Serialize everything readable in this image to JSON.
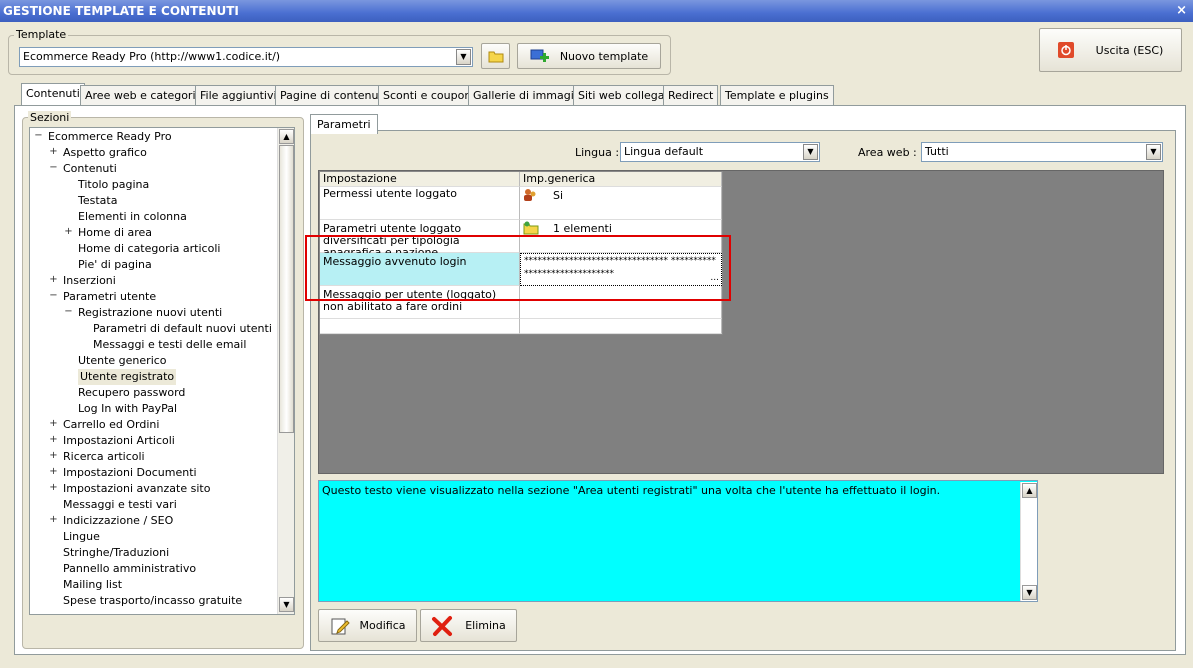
{
  "window": {
    "title": "GESTIONE TEMPLATE E CONTENUTI",
    "close_glyph": "×"
  },
  "template_group": {
    "label": "Template",
    "selected": "Ecommerce Ready Pro (http://www1.codice.it/)",
    "new_template_label": "Nuovo template"
  },
  "exit_button": {
    "label": "Uscita (ESC)"
  },
  "tabs": [
    {
      "label": "Contenuti",
      "active": true
    },
    {
      "label": "Aree web e categorie"
    },
    {
      "label": "File aggiuntivi"
    },
    {
      "label": "Pagine di contenuti"
    },
    {
      "label": "Sconti e coupon"
    },
    {
      "label": "Gallerie di immagini"
    },
    {
      "label": "Siti web collegati"
    },
    {
      "label": "Redirect"
    },
    {
      "label": "Template e plugins"
    }
  ],
  "sections": {
    "label": "Sezioni",
    "tree": [
      {
        "label": "Ecommerce Ready Pro",
        "level": 0,
        "exp": "−"
      },
      {
        "label": "Aspetto grafico",
        "level": 1,
        "exp": "+"
      },
      {
        "label": "Contenuti",
        "level": 1,
        "exp": "−"
      },
      {
        "label": "Titolo pagina",
        "level": 2,
        "exp": ""
      },
      {
        "label": "Testata",
        "level": 2,
        "exp": ""
      },
      {
        "label": "Elementi in colonna",
        "level": 2,
        "exp": ""
      },
      {
        "label": "Home di area",
        "level": 2,
        "exp": "+"
      },
      {
        "label": "Home di categoria articoli",
        "level": 2,
        "exp": ""
      },
      {
        "label": "Pie' di pagina",
        "level": 2,
        "exp": ""
      },
      {
        "label": "Inserzioni",
        "level": 1,
        "exp": "+"
      },
      {
        "label": "Parametri utente",
        "level": 1,
        "exp": "−"
      },
      {
        "label": "Registrazione nuovi utenti",
        "level": 2,
        "exp": "−"
      },
      {
        "label": "Parametri di default nuovi utenti",
        "level": 3,
        "exp": ""
      },
      {
        "label": "Messaggi e testi delle email",
        "level": 3,
        "exp": ""
      },
      {
        "label": "Utente generico",
        "level": 2,
        "exp": ""
      },
      {
        "label": "Utente registrato",
        "level": 2,
        "exp": "",
        "selected": true
      },
      {
        "label": "Recupero password",
        "level": 2,
        "exp": ""
      },
      {
        "label": "Log In with PayPal",
        "level": 2,
        "exp": ""
      },
      {
        "label": "Carrello ed Ordini",
        "level": 1,
        "exp": "+"
      },
      {
        "label": "Impostazioni Articoli",
        "level": 1,
        "exp": "+"
      },
      {
        "label": "Ricerca articoli",
        "level": 1,
        "exp": "+"
      },
      {
        "label": "Impostazioni Documenti",
        "level": 1,
        "exp": "+"
      },
      {
        "label": "Impostazioni avanzate sito",
        "level": 1,
        "exp": "+"
      },
      {
        "label": "Messaggi e testi vari",
        "level": 1,
        "exp": ""
      },
      {
        "label": "Indicizzazione / SEO",
        "level": 1,
        "exp": "+"
      },
      {
        "label": "Lingue",
        "level": 1,
        "exp": ""
      },
      {
        "label": "Stringhe/Traduzioni",
        "level": 1,
        "exp": ""
      },
      {
        "label": "Pannello amministrativo",
        "level": 1,
        "exp": ""
      },
      {
        "label": "Mailing list",
        "level": 1,
        "exp": ""
      },
      {
        "label": "Spese trasporto/incasso gratuite",
        "level": 1,
        "exp": ""
      }
    ]
  },
  "parametri": {
    "tab_label": "Parametri",
    "lingua_label": "Lingua :",
    "lingua_value": "Lingua default",
    "area_label": "Area web :",
    "area_value": "Tutti",
    "grid": {
      "headers": [
        "Impostazione",
        "Imp.generica"
      ],
      "rows": [
        {
          "setting": "Permessi utente loggato",
          "value": "Si",
          "icon": "users-icon"
        },
        {
          "setting": "Parametri utente loggato diversificati per tipologia anagrafica e nazione",
          "value": "1 elementi",
          "icon": "folder-icon"
        },
        {
          "setting": "Messaggio avvenuto login",
          "value": "******************************** ******************************",
          "ellipsis": "...",
          "selected": true
        },
        {
          "setting": "Messaggio per utente (loggato) non abilitato a fare ordini",
          "value": ""
        }
      ]
    },
    "description": "Questo testo viene visualizzato nella sezione \"Area utenti registrati\" una volta che l'utente ha effettuato il login.",
    "modifica_label": "Modifica",
    "elimina_label": "Elimina"
  },
  "colors": {
    "highlight_border": "#e00000",
    "description_bg": "#00ffff",
    "selected_cell": "#b7f0f4"
  }
}
